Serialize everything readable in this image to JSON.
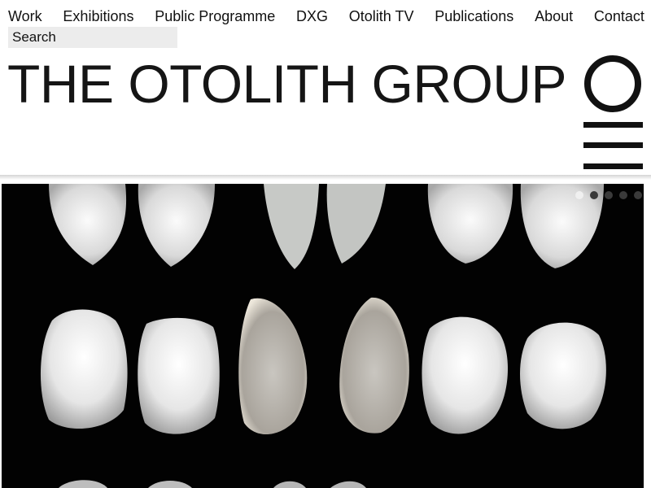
{
  "nav": {
    "items": [
      {
        "label": "Work"
      },
      {
        "label": "Exhibitions"
      },
      {
        "label": "Public Programme"
      },
      {
        "label": "DXG"
      },
      {
        "label": "Otolith TV"
      },
      {
        "label": "Publications"
      },
      {
        "label": "About"
      },
      {
        "label": "Contact"
      }
    ]
  },
  "search": {
    "placeholder": "Search",
    "icon": "none"
  },
  "header": {
    "title": "THE OTOLITH GROUP",
    "logo": "circle-logo",
    "menu_icon": "hamburger-icon"
  },
  "slider": {
    "image_subject": "fish otoliths on black background",
    "slide_count": 5,
    "active_slide": 1
  },
  "colors": {
    "text": "#111111",
    "search_bg": "#ececec",
    "slider_bg": "#020202",
    "dot_active": "#f0f0f0",
    "dot_inactive": "#3a3a3a"
  }
}
